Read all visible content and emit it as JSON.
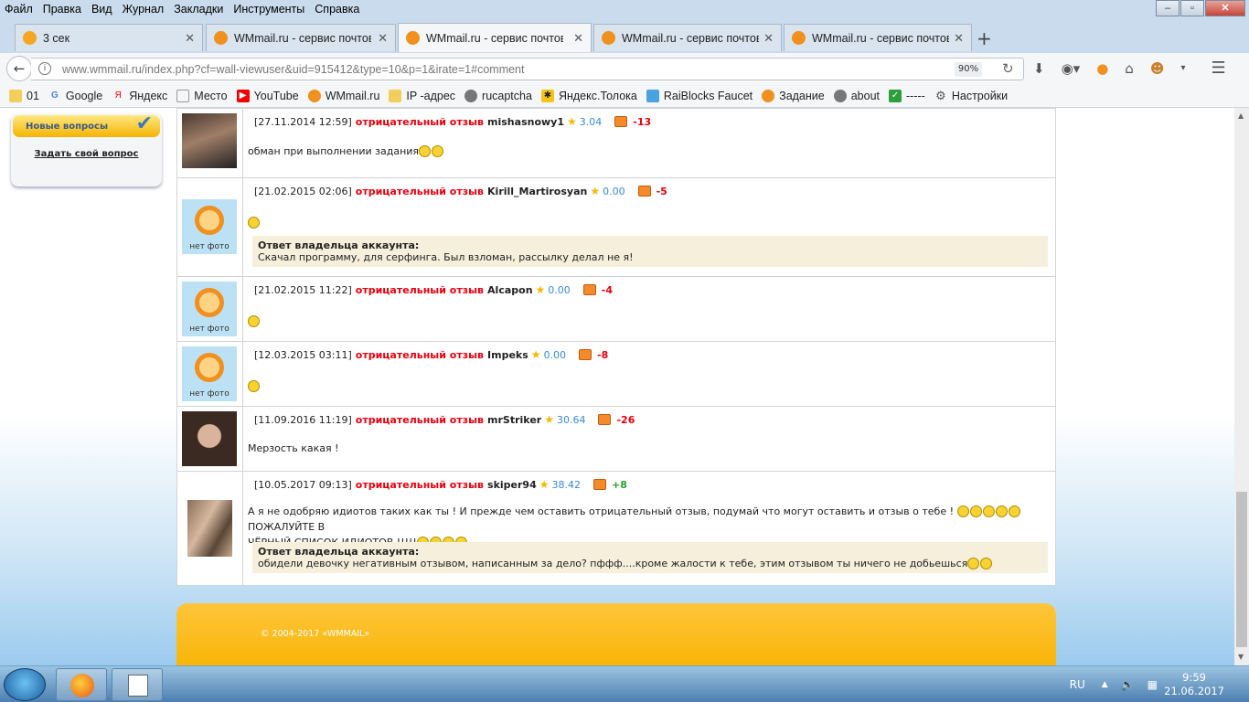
{
  "menu": [
    "Файл",
    "Правка",
    "Вид",
    "Журнал",
    "Закладки",
    "Инструменты",
    "Справка"
  ],
  "tabs": [
    {
      "title": "3 сек",
      "active": false
    },
    {
      "title": "WMmail.ru - сервис почтов",
      "active": false
    },
    {
      "title": "WMmail.ru - сервис почтов",
      "active": true
    },
    {
      "title": "WMmail.ru - сервис почтов",
      "active": false
    },
    {
      "title": "WMmail.ru - сервис почтов",
      "active": false
    }
  ],
  "address": {
    "url": "www.wmmail.ru/index.php?cf=wall-viewuser&uid=915412&type=10&p=1&irate=1#comment",
    "zoom": "90%"
  },
  "bookmarks": [
    "01",
    "Google",
    "Яндекс",
    "Место",
    "YouTube",
    "WMmail.ru",
    "IP -адрес",
    "rucaptcha",
    "Яндекс.Толока",
    "RaiBlocks Faucet",
    "Задание",
    "about",
    "-----",
    "Настройки"
  ],
  "sidebar": {
    "header": "Новые вопросы",
    "link": "Задать свой вопрос"
  },
  "entries": [
    {
      "date": "[27.11.2014 12:59]",
      "type": "отрицательный отзыв",
      "user": "mishasnowy1",
      "rating": "3.04",
      "points": "-13",
      "text": "обман при выполнении задания",
      "avatar": "photo",
      "no_photo": ""
    },
    {
      "date": "[21.02.2015 02:06]",
      "type": "отрицательный отзыв",
      "user": "Kirill_Martirosyan",
      "rating": "0.00",
      "points": "-5",
      "text": "",
      "avatar": "nophoto",
      "no_photo": "нет фото",
      "reply_title": "Ответ владельца аккаунта:",
      "reply_text": "Скачал программу, для серфинга. Был взломан, рассылку делал не я!"
    },
    {
      "date": "[21.02.2015 11:22]",
      "type": "отрицательный отзыв",
      "user": "Alcapon",
      "rating": "0.00",
      "points": "-4",
      "text": "",
      "avatar": "nophoto",
      "no_photo": "нет фото"
    },
    {
      "date": "[12.03.2015 03:11]",
      "type": "отрицательный отзыв",
      "user": "Impeks",
      "rating": "0.00",
      "points": "-8",
      "text": "",
      "avatar": "nophoto",
      "no_photo": "нет фото"
    },
    {
      "date": "[11.09.2016 11:19]",
      "type": "отрицательный отзыв",
      "user": "mrStriker",
      "rating": "30.64",
      "points": "-26",
      "text": "Мерзость какая !",
      "avatar": "photo",
      "no_photo": ""
    },
    {
      "date": "[10.05.2017 09:13]",
      "type": "отрицательный отзыв",
      "user": "skiper94",
      "rating": "38.42",
      "points": "+8",
      "text1": "А я не одобряю идиотов таких как ты ! И прежде чем оставить отрицательный отзыв, подумай что могут оставить и отзыв о тебе !",
      "text2": "ПОЖАЛУЙТЕ В",
      "text3": "ЧЁРНЫЙ СПИСОК ИДИОТОВ !!!!!",
      "avatar": "photo",
      "no_photo": "",
      "reply_title": "Ответ владельца аккаунта:",
      "reply_text": "обидели девочку негативным отзывом, написанным за дело? пффф....кроме жалости к тебе, этим отзывом ты ничего не добьешься"
    }
  ],
  "footer": {
    "copyright": "© 2004-2017 «WMMAIL»"
  },
  "taskbar": {
    "lang": "RU",
    "time": "9:59",
    "date": "21.06.2017"
  }
}
